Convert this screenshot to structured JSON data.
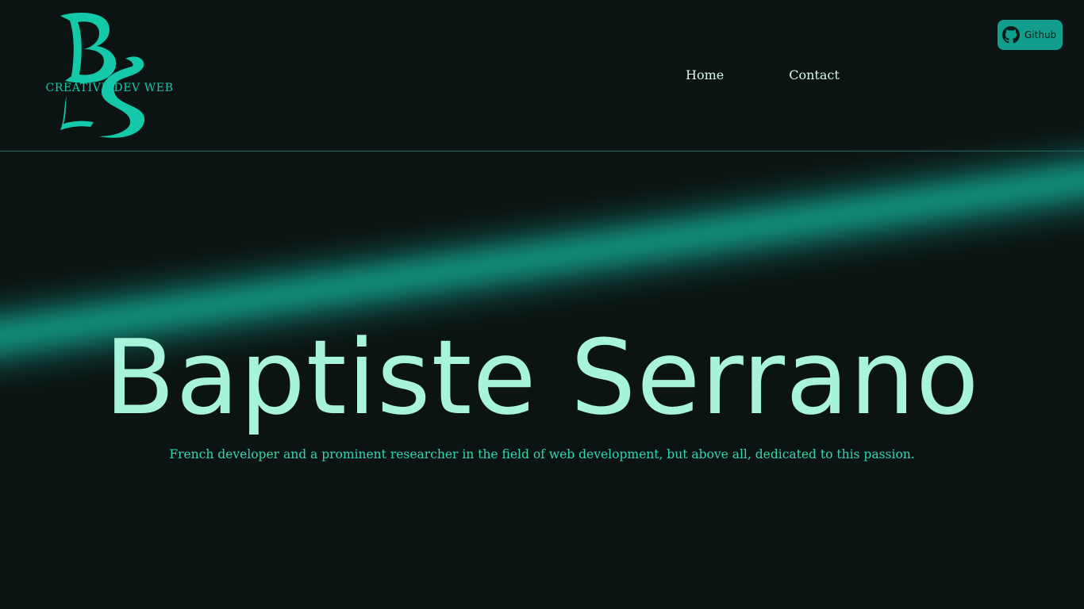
{
  "header": {
    "logo": {
      "monogram": "BS",
      "tagline": "CREATIVE DEV WEB",
      "color": "#14c9a9"
    },
    "nav": {
      "items": [
        {
          "label": "Home"
        },
        {
          "label": "Contact"
        }
      ]
    },
    "github_button": {
      "label": "Github",
      "icon": "github-icon",
      "color": "#119e8c"
    }
  },
  "hero": {
    "title": "Baptiste Serrano",
    "subtitle": "French developer and a prominent researcher in the field of web development, but above all, dedicated to this passion."
  },
  "colors": {
    "background": "#0c1413",
    "accent": "#14c9a9",
    "title": "#a8f3dc",
    "subtitle": "#2fd8b3",
    "nav_text": "#d9f7ef"
  }
}
